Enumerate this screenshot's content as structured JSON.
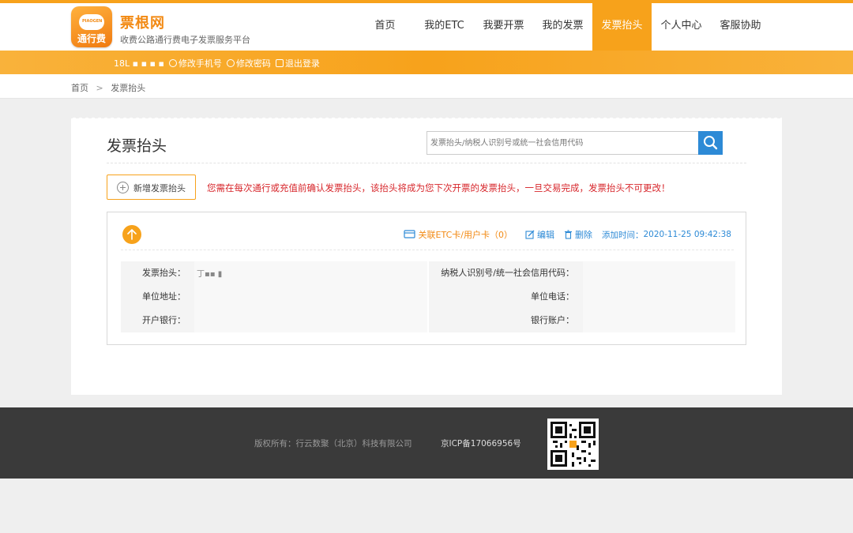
{
  "brand": {
    "logo_text": "通行费",
    "logo_tag": "PIAOGEN",
    "title": "票根网",
    "subtitle": "收费公路通行费电子发票服务平台"
  },
  "nav": {
    "items": [
      {
        "label": "首页",
        "active": false
      },
      {
        "label": "我的ETC",
        "active": false
      },
      {
        "label": "我要开票",
        "active": false
      },
      {
        "label": "我的发票",
        "active": false
      },
      {
        "label": "发票抬头",
        "active": true
      },
      {
        "label": "个人中心",
        "active": false
      },
      {
        "label": "客服协助",
        "active": false
      }
    ]
  },
  "subbar": {
    "phone_masked": "18L ▪ ▪ ▪ ▪",
    "change_phone": "修改手机号",
    "change_password": "修改密码",
    "logout": "退出登录"
  },
  "breadcrumb": {
    "home": "首页",
    "separator": ">",
    "current": "发票抬头"
  },
  "main": {
    "title": "发票抬头",
    "search": {
      "placeholder": "发票抬头/纳税人识别号或统一社会信用代码",
      "value": ""
    },
    "add_button": "新增发票抬头",
    "notice": "您需在每次通行或充值前确认发票抬头，该抬头将成为您下次开票的发票抬头，一旦交易完成，发票抬头不可更改！"
  },
  "card": {
    "linked_cards": "关联ETC卡/用户卡（0）",
    "edit": "编辑",
    "delete": "删除",
    "added_time_label": "添加时间：",
    "added_time": "2020-11-25 09:42:38",
    "fields": {
      "invoice_title_label": "发票抬头：",
      "invoice_title_value": "丁▪▪ ▮",
      "tax_id_label": "纳税人识别号/统一社会信用代码：",
      "tax_id_value": "",
      "address_label": "单位地址：",
      "address_value": "",
      "phone_label": "单位电话：",
      "phone_value": "",
      "bank_label": "开户银行：",
      "bank_value": "",
      "account_label": "银行账户：",
      "account_value": ""
    }
  },
  "footer": {
    "copyright": "版权所有：行云数聚（北京）科技有限公司",
    "icp": "京ICP备17066956号"
  },
  "colors": {
    "accent": "#f7a21b",
    "link_blue": "#2d8ad6",
    "warning_red": "#d7262b",
    "footer_bg": "#3a3a3a"
  },
  "icons": [
    "search-icon",
    "plus-circle-icon",
    "arrow-up-icon",
    "card-icon",
    "edit-icon",
    "trash-icon",
    "phone-icon",
    "lock-icon",
    "logout-icon",
    "qr-code"
  ]
}
